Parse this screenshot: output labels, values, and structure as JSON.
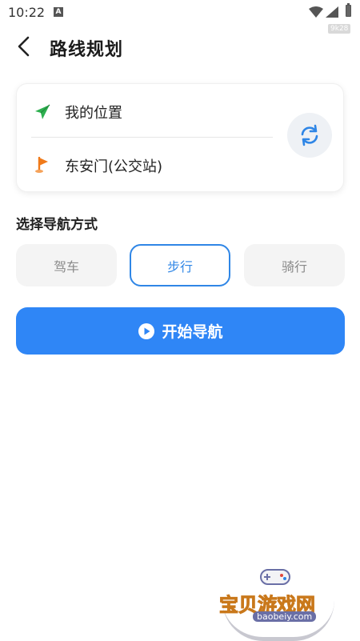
{
  "status_bar": {
    "time": "10:22",
    "notification_icon": "A",
    "net_speed": "9k28"
  },
  "header": {
    "back_icon": "chevron-left-icon",
    "title": "路线规划"
  },
  "route": {
    "origin": "我的位置",
    "origin_icon": "send-arrow-icon",
    "origin_icon_color": "#2db04f",
    "destination": "东安门(公交站)",
    "destination_icon": "flag-icon",
    "destination_icon_color": "#f07a1a",
    "swap_icon": "refresh-swap-icon"
  },
  "mode_section": {
    "label": "选择导航方式",
    "modes": [
      {
        "label": "驾车",
        "selected": false
      },
      {
        "label": "步行",
        "selected": true
      },
      {
        "label": "骑行",
        "selected": false
      }
    ]
  },
  "start_button": {
    "label": "开始导航",
    "icon": "play-circle-icon",
    "color": "#2f86f6"
  },
  "watermark": {
    "title": "宝贝游戏网",
    "url": "baobeiy.com"
  },
  "colors": {
    "accent": "#2f86e6"
  }
}
